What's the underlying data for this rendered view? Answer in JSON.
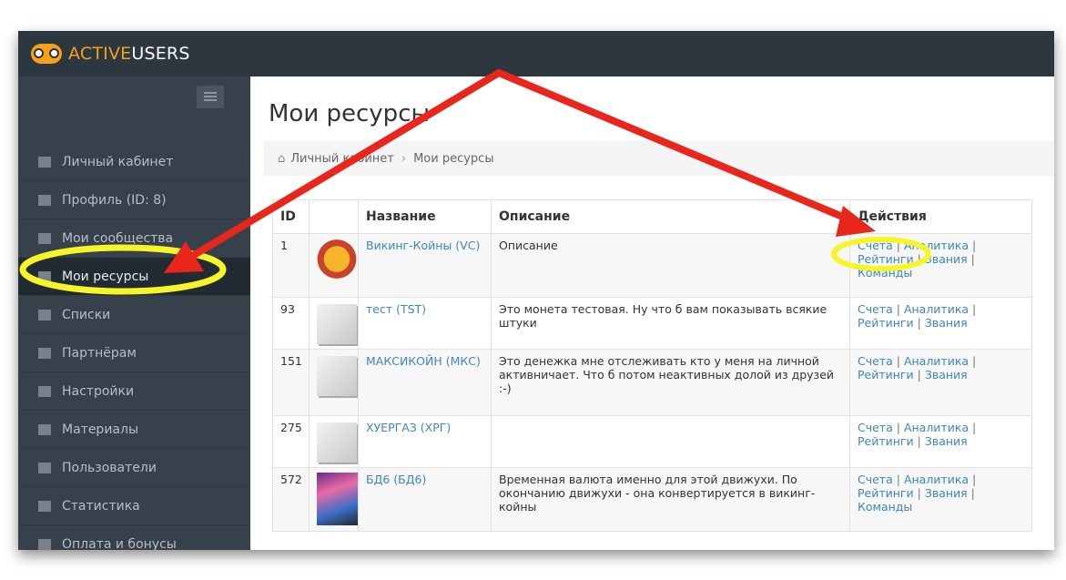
{
  "app": {
    "logo_part1": "ACTIVE",
    "logo_part2": "USERS"
  },
  "sidebar": {
    "items": [
      {
        "label": "Личный кабинет",
        "icon": "home-icon"
      },
      {
        "label": "Профиль (ID: 8)",
        "icon": "user-icon"
      },
      {
        "label": "Мои сообщества",
        "icon": "group-icon"
      },
      {
        "label": "Мои ресурсы",
        "icon": "coins-icon",
        "active": true
      },
      {
        "label": "Списки",
        "icon": "list-icon"
      },
      {
        "label": "Партнёрам",
        "icon": "partner-icon"
      },
      {
        "label": "Настройки",
        "icon": "gears-icon"
      },
      {
        "label": "Материалы",
        "icon": "menu-icon"
      },
      {
        "label": "Пользователи",
        "icon": "users-icon"
      },
      {
        "label": "Статистика",
        "icon": "chart-icon"
      },
      {
        "label": "Оплата и бонусы",
        "icon": "visa-icon"
      }
    ]
  },
  "page": {
    "title": "Мои ресурсы"
  },
  "breadcrumb": {
    "home": "Личный кабинет",
    "current": "Мои ресурсы"
  },
  "table": {
    "headers": {
      "id": "ID",
      "name": "Название",
      "description": "Описание",
      "actions": "Действия"
    },
    "actions": {
      "accounts": "Счета",
      "analytics": "Аналитика",
      "ratings": "Рейтинги",
      "ranks": "Звания",
      "teams": "Команды",
      "sep": "|"
    },
    "rows": [
      {
        "id": "1",
        "name": "Викинг-Койны (VC)",
        "description": "Описание"
      },
      {
        "id": "93",
        "name": "тест (TST)",
        "description": "Это монета тестовая. Ну что б вам показывать всякие штуки"
      },
      {
        "id": "151",
        "name": "МАКСИКОЙН (МКС)",
        "description": "Это денежка мне отслеживать кто у меня на личной активничает. Что б потом неактивных долой из друзей :-)"
      },
      {
        "id": "275",
        "name": "ХУЕРГАЗ (ХРГ)",
        "description": ""
      },
      {
        "id": "572",
        "name": "БД6 (БД6)",
        "description": "Временная валюта именно для этой движухи. По окончанию движухи - она конвертируется в викинг-койны"
      }
    ]
  },
  "colors": {
    "sidebar": "#37414b",
    "topbar": "#2d3740",
    "link": "#3e86c0",
    "arrow": "#e8261b",
    "highlight": "#f5f52a"
  }
}
